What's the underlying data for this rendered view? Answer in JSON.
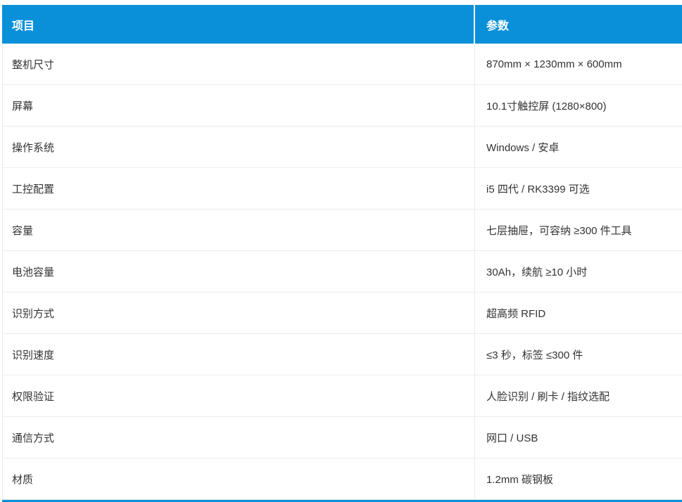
{
  "table": {
    "columns": [
      "项目",
      "参数"
    ],
    "rows": [
      {
        "item": "整机尺寸",
        "param": "870mm × 1230mm × 600mm"
      },
      {
        "item": "屏幕",
        "param": "10.1寸触控屏 (1280×800)"
      },
      {
        "item": "操作系统",
        "param": "Windows / 安卓"
      },
      {
        "item": "工控配置",
        "param": "i5 四代 / RK3399 可选"
      },
      {
        "item": "容量",
        "param": "七层抽屉，可容纳 ≥300 件工具"
      },
      {
        "item": "电池容量",
        "param": "30Ah，续航 ≥10 小时"
      },
      {
        "item": "识别方式",
        "param": "超高频 RFID"
      },
      {
        "item": "识别速度",
        "param": "≤3 秒，标签 ≤300 件"
      },
      {
        "item": "权限验证",
        "param": "人脸识别 / 刷卡 / 指纹选配"
      },
      {
        "item": "通信方式",
        "param": "网口 / USB"
      },
      {
        "item": "材质",
        "param": "1.2mm 碳钢板"
      }
    ]
  },
  "colors": {
    "header_bg": "#0a90d9",
    "header_text": "#ffffff",
    "body_text": "#333333",
    "divider": "#e8e8e8",
    "row_divider": "#ececec"
  }
}
